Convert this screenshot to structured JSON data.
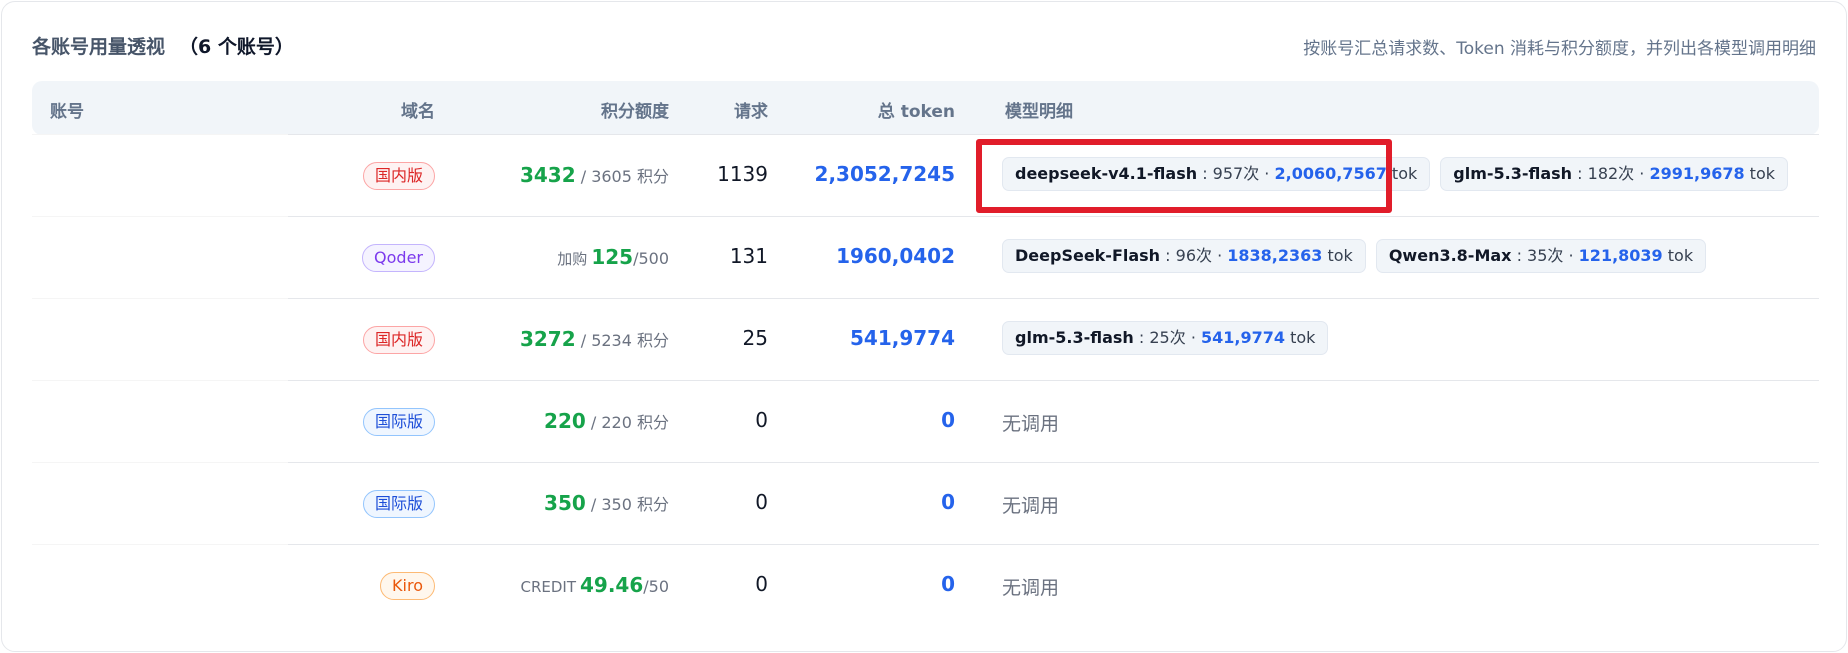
{
  "header": {
    "title": "各账号用量透视",
    "count": "（6 个账号）",
    "subtitle": "按账号汇总请求数、Token 消耗与积分额度，并列出各模型调用明细"
  },
  "columns": {
    "account": "账号",
    "domain": "域名",
    "credit": "积分额度",
    "requests": "请求",
    "total_token": "总 token",
    "model_detail": "模型明细"
  },
  "rows": [
    {
      "badge": "国内版",
      "credit_prefix": "",
      "credit_used": "3432",
      "credit_total": " / 3605 积分",
      "requests": "1139",
      "total_token": "2,3052,7245",
      "models": [
        {
          "name": "deepseek-v4.1-flash",
          "calls": " : 957次 · ",
          "tokens": "2,0060,7567",
          "unit": " tok"
        },
        {
          "name": "glm-5.3-flash",
          "calls": " : 182次 · ",
          "tokens": "2991,9678",
          "unit": " tok"
        }
      ]
    },
    {
      "badge": "Qoder",
      "credit_prefix": "加购",
      "credit_used": "125",
      "credit_total": "/500",
      "requests": "131",
      "total_token": "1960,0402",
      "models": [
        {
          "name": "DeepSeek-Flash",
          "calls": " : 96次 · ",
          "tokens": "1838,2363",
          "unit": " tok"
        },
        {
          "name": "Qwen3.8-Max",
          "calls": " : 35次 · ",
          "tokens": "121,8039",
          "unit": " tok"
        }
      ]
    },
    {
      "badge": "国内版",
      "credit_prefix": "",
      "credit_used": "3272",
      "credit_total": " / 5234 积分",
      "requests": "25",
      "total_token": "541,9774",
      "models": [
        {
          "name": "glm-5.3-flash",
          "calls": " : 25次 · ",
          "tokens": "541,9774",
          "unit": " tok"
        }
      ]
    },
    {
      "badge": "国际版",
      "credit_prefix": "",
      "credit_used": "220",
      "credit_total": " / 220 积分",
      "requests": "0",
      "total_token": "0",
      "no_call": "无调用"
    },
    {
      "badge": "国际版",
      "credit_prefix": "",
      "credit_used": "350",
      "credit_total": " / 350 积分",
      "requests": "0",
      "total_token": "0",
      "no_call": "无调用"
    },
    {
      "badge": "Kiro",
      "credit_prefix": "CREDIT",
      "credit_used": "49.46",
      "credit_total": "/50",
      "requests": "0",
      "total_token": "0",
      "no_call": "无调用"
    }
  ],
  "colors": {
    "credit_green": "#16a34a",
    "token_blue": "#2563eb",
    "highlight_red": "#e11d2a"
  }
}
